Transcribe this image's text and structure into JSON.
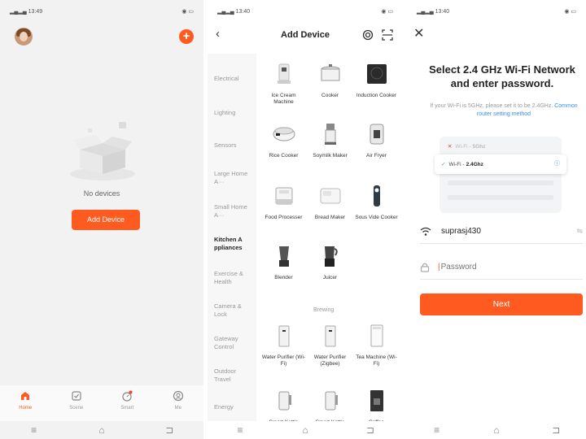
{
  "phone1": {
    "status_time": "13:49",
    "no_devices_text": "No devices",
    "add_device_button": "Add Device",
    "tabs": [
      {
        "label": "Home",
        "icon": "home-icon",
        "active": true
      },
      {
        "label": "Scene",
        "icon": "scene-icon",
        "active": false
      },
      {
        "label": "Smart",
        "icon": "smart-icon",
        "active": false
      },
      {
        "label": "Me",
        "icon": "me-icon",
        "active": false
      }
    ]
  },
  "phone2": {
    "status_time": "13:40",
    "title": "Add Device",
    "categories": [
      "Electrical",
      "Lighting",
      "Sensors",
      "Large Home A···",
      "Small Home A···",
      "Kitchen A ppliances",
      "Exercise & Health",
      "Camera & Lock",
      "Gateway Control",
      "Outdoor Travel",
      "Energy"
    ],
    "active_category": "Kitchen A ppliances",
    "devices": [
      "Ice Cream Machine",
      "Cooker",
      "Induction Cooker",
      "Rice Cooker",
      "Soymilk Maker",
      "Air Fryer",
      "Food Processer",
      "Bread Maker",
      "Sous Vide Cooker",
      "Blender",
      "Juicer"
    ],
    "section_label": "Brewing",
    "brewing_devices": [
      "Water Purifier (Wi-Fi)",
      "Water Purifier (Zigbee)",
      "Tea Machine (Wi-Fi)",
      "Smart Kettle",
      "Smart Kettle",
      "Coffee"
    ]
  },
  "phone3": {
    "status_time": "13:40",
    "title": "Select 2.4 GHz Wi-Fi Network and enter password.",
    "subtitle": "If your Wi-Fi is 5GHz, please set it to be 2.4GHz.",
    "link_text": "Common router setting method",
    "wifi_5g_prefix": "Wi-Fi - ",
    "wifi_5g_band": "5Ghz",
    "wifi_24_prefix": "Wi-Fi - ",
    "wifi_24_band": "2.4Ghz",
    "ssid": "suprasj430",
    "password_placeholder": "Password",
    "next_button": "Next"
  },
  "colors": {
    "accent": "#ff5a1f",
    "link": "#3a8ee6"
  }
}
